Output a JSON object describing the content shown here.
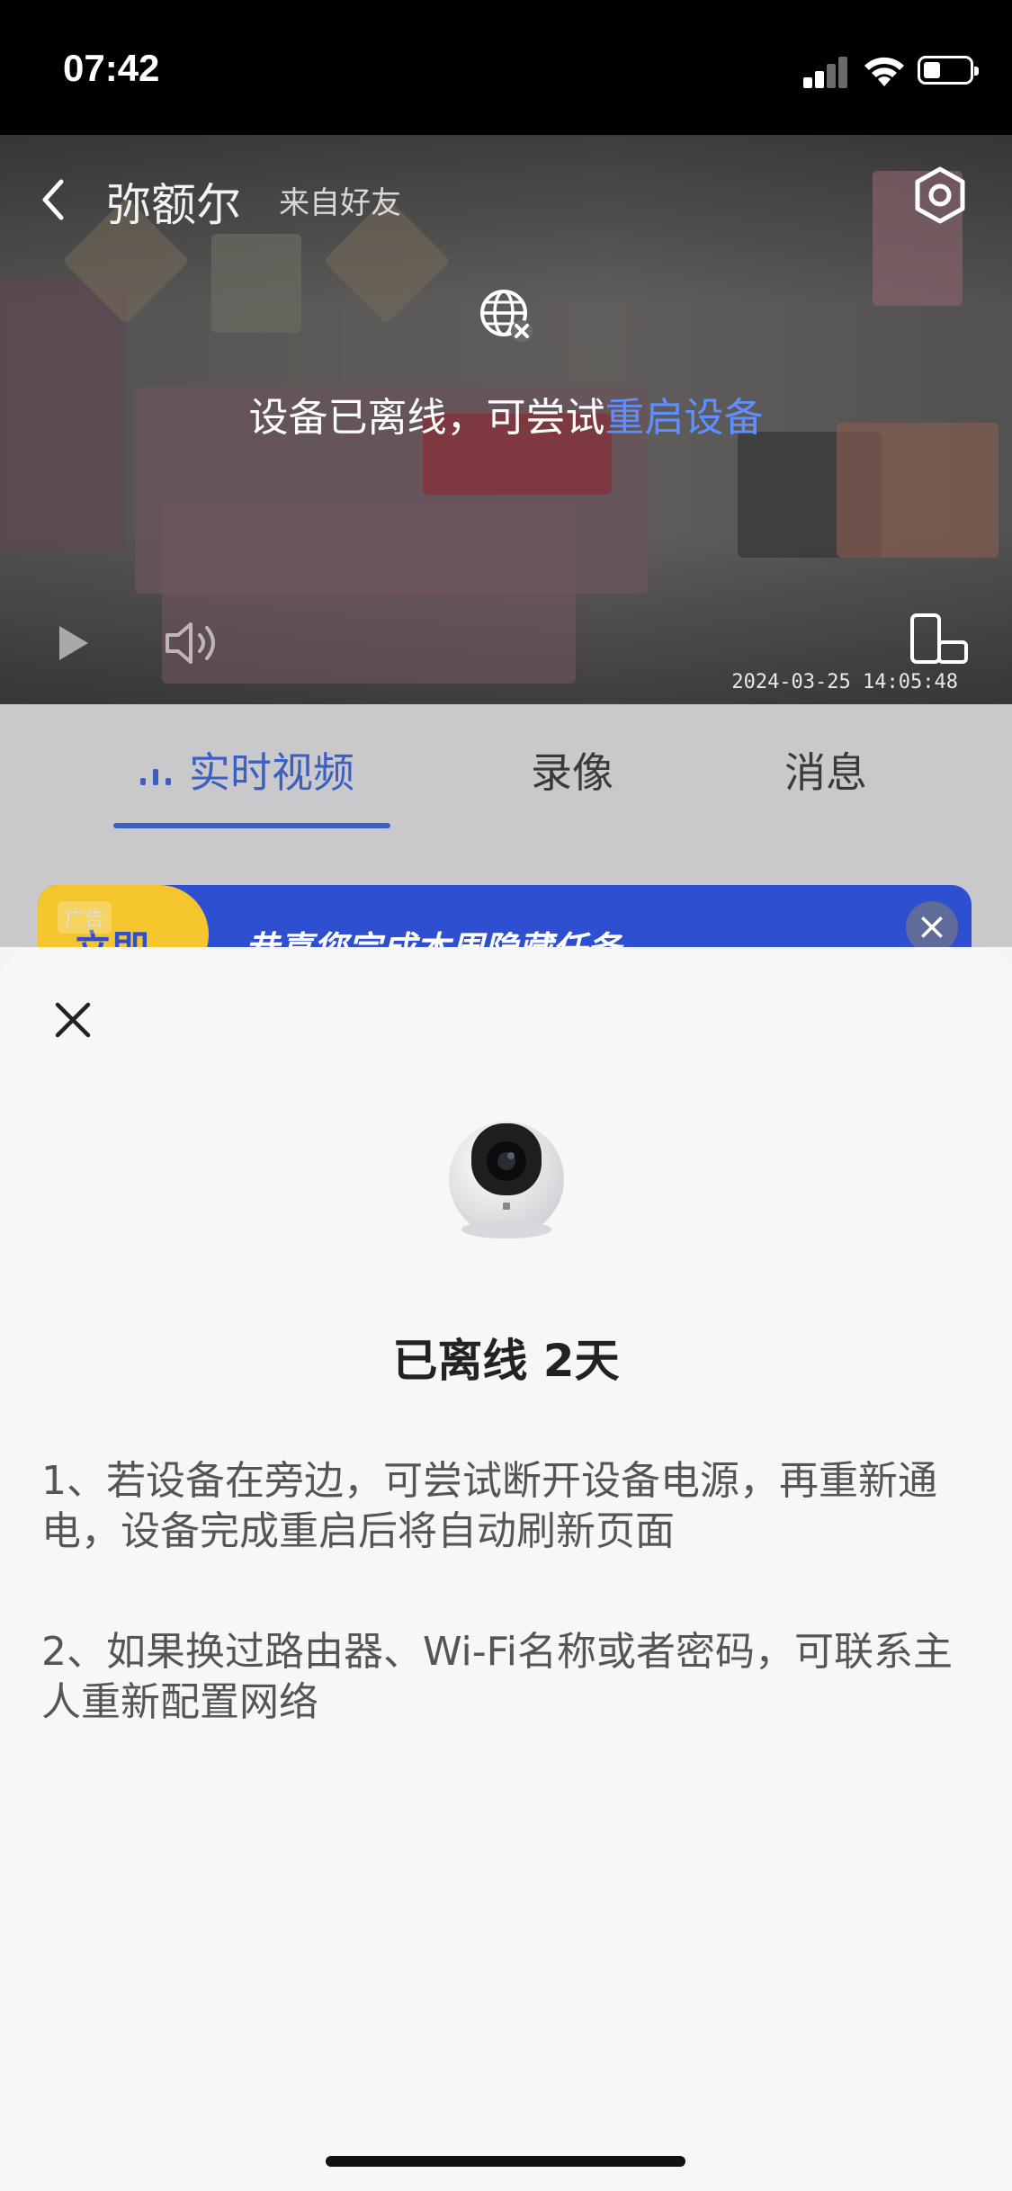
{
  "status_bar": {
    "time": "07:42"
  },
  "header": {
    "device_name": "弥额尔",
    "source": "来自好友"
  },
  "video": {
    "offline_prefix": "设备已离线，可尝试",
    "offline_link": "重启设备",
    "timestamp": "2024-03-25 14:05:48"
  },
  "tabs": [
    {
      "label": "实时视频"
    },
    {
      "label": "录像"
    },
    {
      "label": "消息"
    }
  ],
  "banner": {
    "ad_tag": "广告",
    "left_text": "立即",
    "text": "恭喜您完成本周隐藏任务"
  },
  "sheet": {
    "headline": "已离线 2天",
    "tip1": "1、若设备在旁边，可尝试断开设备电源，再重新通电，设备完成重启后将自动刷新页面",
    "tip2": "2、如果换过路由器、Wi-Fi名称或者密码，可联系主人重新配置网络"
  },
  "colors": {
    "accent": "#3e5fc2",
    "link": "#5f8fff",
    "sheet_bg": "#f7f7f9"
  }
}
